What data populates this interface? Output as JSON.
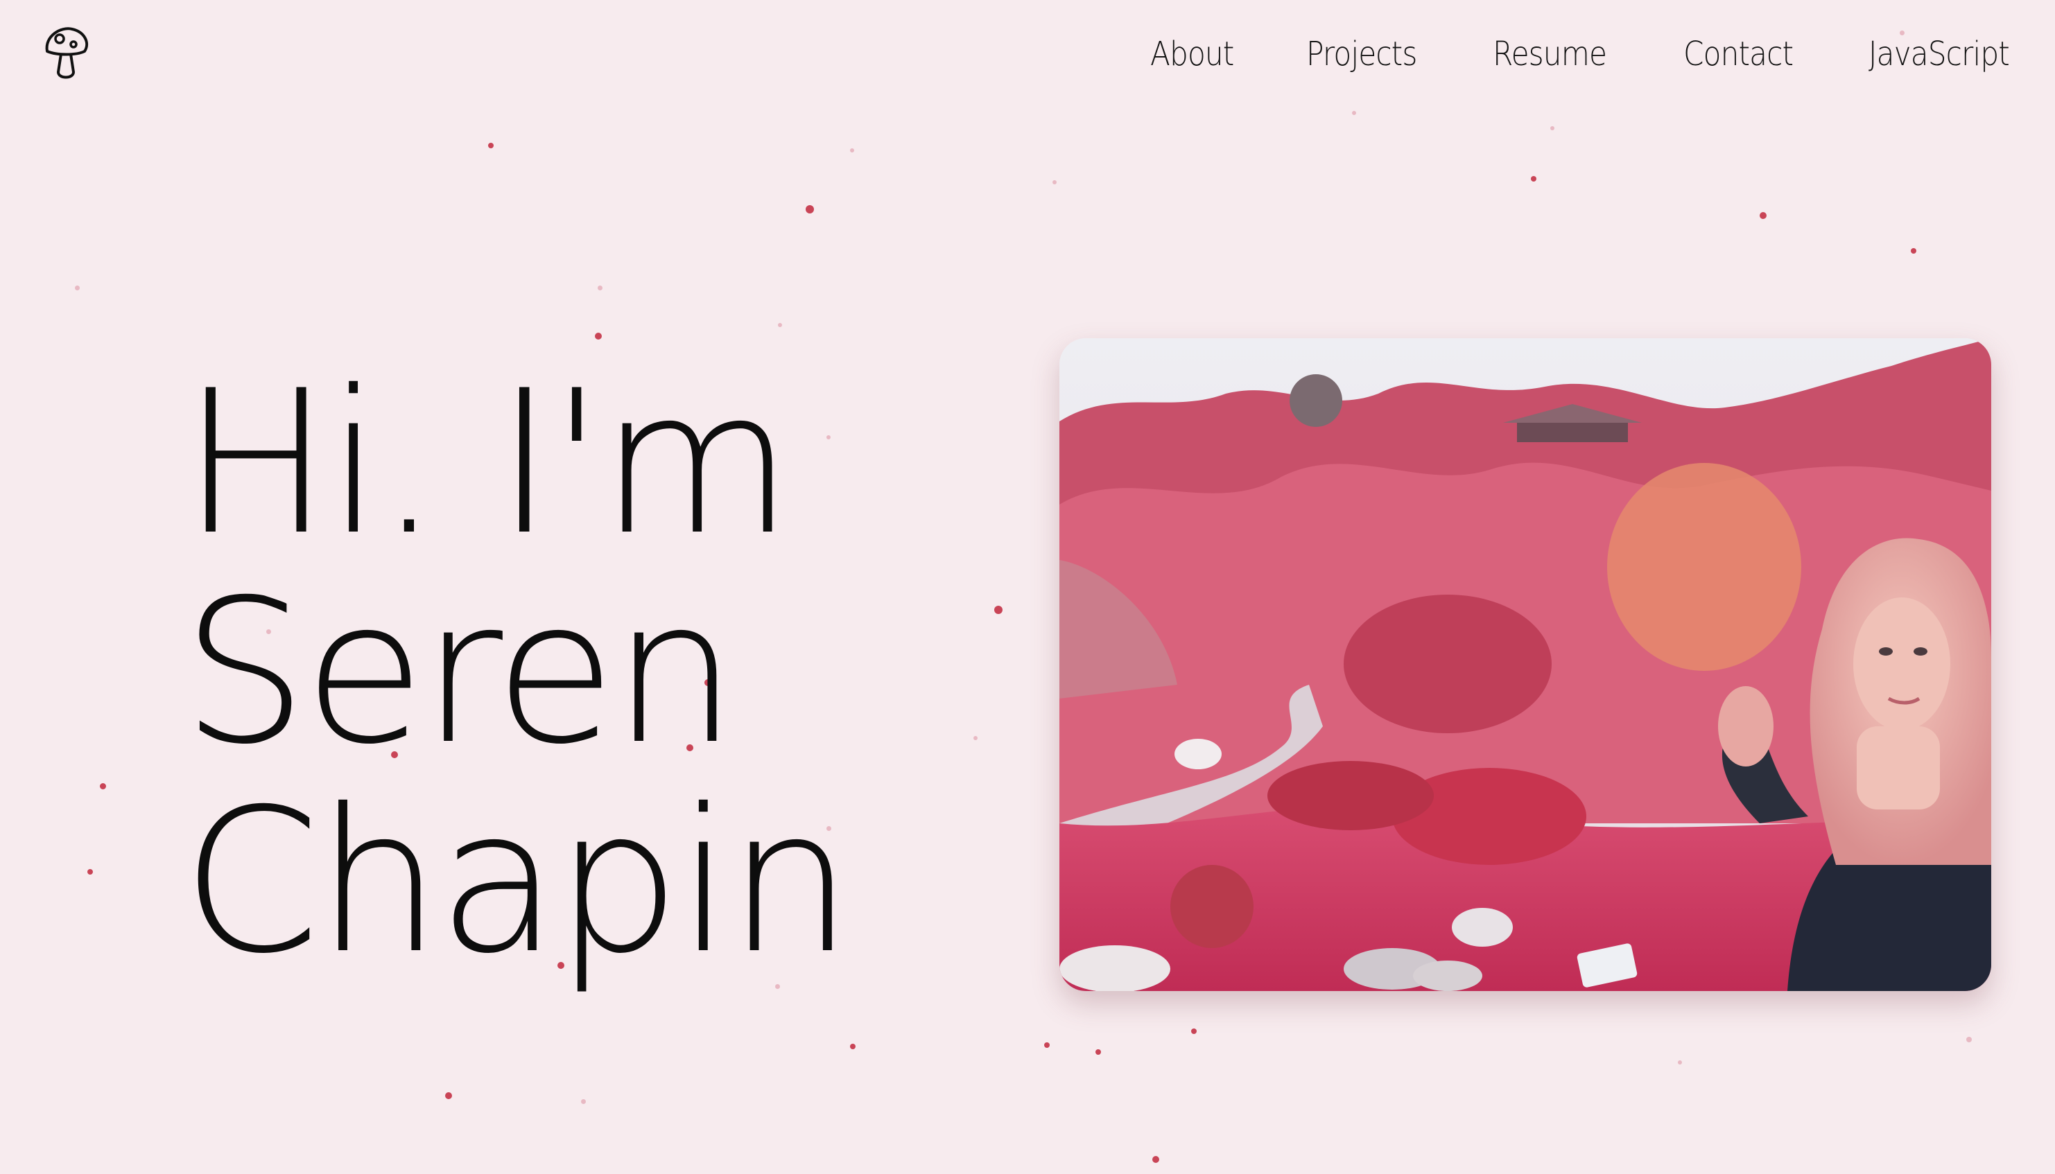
{
  "nav": {
    "items": [
      "About",
      "Projects",
      "Resume",
      "Contact",
      "JavaScript"
    ]
  },
  "hero": {
    "line1": "Hi. I'm",
    "line2": "Seren",
    "line3": "Chapin"
  },
  "icons": {
    "logo": "mushroom-icon"
  },
  "colors": {
    "background": "#f7ebee",
    "dot": "#c94456",
    "text": "#0d0d0d"
  }
}
